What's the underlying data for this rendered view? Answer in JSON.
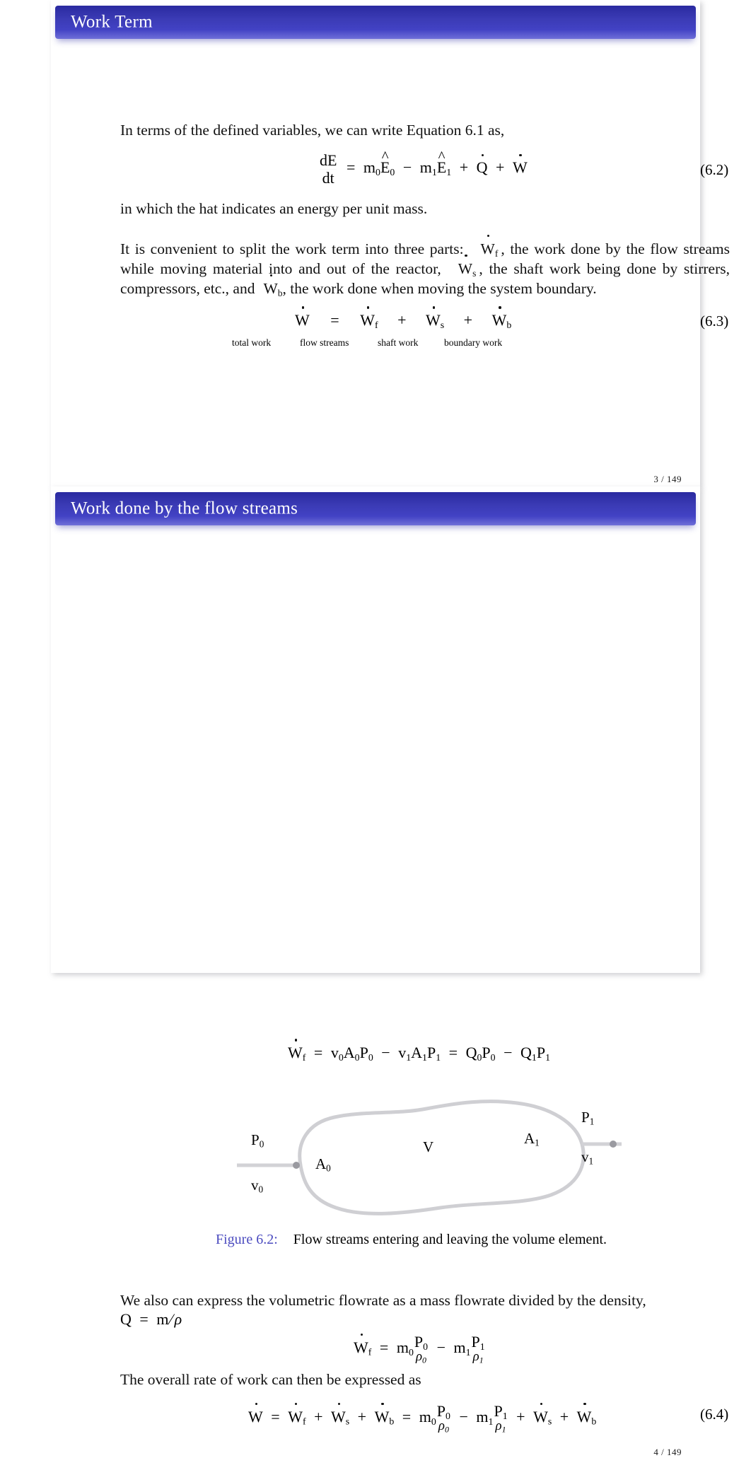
{
  "document": {
    "type": "lecture-slides",
    "accent_color": "#3b3bb5",
    "caption_link_color": "#4b4bbf"
  },
  "slide1": {
    "title": "Work Term",
    "page_number": "3 / 149",
    "intro_paragraph": "In terms of the defined variables, we can write Equation 6.1 as,",
    "equation_6_2": {
      "tag": "(6.2)",
      "lhs_numerator": "dE",
      "lhs_denominator": "dt",
      "equals": "=",
      "term_1": "m",
      "term_1_sub": "0",
      "term_1_energy": "E",
      "term_1_energy_sub": "0",
      "minus": "−",
      "term_2": "m",
      "term_2_sub": "1",
      "term_2_energy": "E",
      "term_2_energy_sub": "1",
      "plus_1": "+",
      "heat": "Q",
      "plus_2": "+",
      "work": "W"
    },
    "hat_note": "in which the hat indicates an energy per unit mass.",
    "split_paragraph": {
      "part_1": "It is convenient to split the work term into three parts:",
      "sym_1": "W",
      "sym_1_sub": "f",
      "part_2": ", the work done by the flow streams while moving material into and out of the reactor,",
      "sym_2": "W",
      "sym_2_sub": "s",
      "part_3": ", the shaft work being done by stirrers, compressors, etc., and",
      "sym_3": "W",
      "sym_3_sub": "b",
      "part_4": ", the work done when moving the system boundary."
    },
    "equation_6_3": {
      "tag": "(6.3)",
      "total": "W",
      "equals": "=",
      "flow": "W",
      "flow_sub": "f",
      "plus_1": "+",
      "shaft": "W",
      "shaft_sub": "s",
      "plus_2": "+",
      "boundary": "W",
      "boundary_sub": "b",
      "label_total": "total work",
      "label_flow": "flow streams",
      "label_shaft": "shaft work",
      "label_boundary": "boundary work"
    }
  },
  "slide2": {
    "title": "Work done by the flow streams",
    "page_number": "4 / 149",
    "equation_flow_work": {
      "lhs": "W",
      "lhs_sub": "f",
      "equals_1": "=",
      "t1_v": "v",
      "t1_v_sub": "0",
      "t1_a": "A",
      "t1_a_sub": "0",
      "t1_p": "P",
      "t1_p_sub": "0",
      "minus_1": "−",
      "t2_v": "v",
      "t2_v_sub": "1",
      "t2_a": "A",
      "t2_a_sub": "1",
      "t2_p": "P",
      "t2_p_sub": "1",
      "equals_2": "=",
      "t3_q": "Q",
      "t3_q_sub": "0",
      "t3_p": "P",
      "t3_p_sub": "0",
      "minus_2": "−",
      "t4_q": "Q",
      "t4_q_sub": "1",
      "t4_p": "P",
      "t4_p_sub": "1"
    },
    "figure": {
      "caption_lead": "Figure 6.2:",
      "caption_text": "Flow streams entering and leaving the volume element.",
      "label_p0": "P",
      "label_p0_sub": "0",
      "label_v0": "v",
      "label_v0_sub": "0",
      "label_a0": "A",
      "label_a0_sub": "0",
      "label_volume": "V",
      "label_a1": "A",
      "label_a1_sub": "1",
      "label_p1": "P",
      "label_p1_sub": "1",
      "label_v1": "v",
      "label_v1_sub": "1"
    },
    "density_paragraph": "We also can express the volumetric flowrate as a mass flowrate divided by the density,",
    "density_relation": {
      "q": "Q",
      "equals": "=",
      "m": "m",
      "slash": "/",
      "rho": "ρ"
    },
    "equation_flow_density": {
      "lhs": "W",
      "lhs_sub": "f",
      "equals": "=",
      "m0": "m",
      "m0_sub": "0",
      "p0": "P",
      "p0_sub": "0",
      "rho0": "ρ",
      "rho0_sub": "0",
      "minus": "−",
      "m1": "m",
      "m1_sub": "1",
      "p1": "P",
      "p1_sub": "1",
      "rho1": "ρ",
      "rho1_sub": "1"
    },
    "overall_rate_text": "The overall rate of work can then be expressed as",
    "equation_6_4": {
      "tag": "(6.4)",
      "w": "W",
      "equals_1": "=",
      "wf": "W",
      "wf_sub": "f",
      "plus_1": "+",
      "ws": "W",
      "ws_sub": "s",
      "plus_2": "+",
      "wb": "W",
      "wb_sub": "b",
      "equals_2": "=",
      "m0": "m",
      "m0_sub": "0",
      "p0": "P",
      "p0_sub": "0",
      "rho0": "ρ",
      "rho0_sub": "0",
      "minus": "−",
      "m1": "m",
      "m1_sub": "1",
      "p1": "P",
      "p1_sub": "1",
      "rho1": "ρ",
      "rho1_sub": "1",
      "plus_3": "+",
      "ws2": "W",
      "ws2_sub": "s",
      "plus_4": "+",
      "wb2": "W",
      "wb2_sub": "b"
    }
  }
}
